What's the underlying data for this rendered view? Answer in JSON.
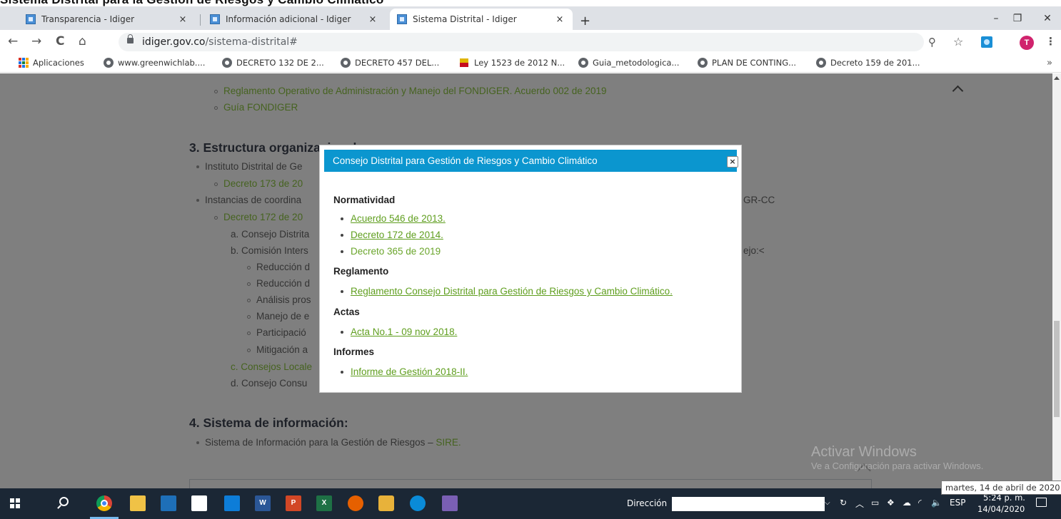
{
  "browser": {
    "tabs": [
      {
        "title": "Transparencia - Idiger",
        "close": "×"
      },
      {
        "title": "Información adicional - Idiger",
        "close": "×"
      },
      {
        "title": "Sistema Distrital - Idiger",
        "close": "×"
      }
    ],
    "new_tab": "+",
    "window_controls": {
      "minimize": "–",
      "restore": "❐",
      "close": "✕"
    },
    "nav": {
      "back": "←",
      "forward": "→",
      "reload": "C",
      "home": "⌂"
    },
    "url_host": "idiger.gov.co",
    "url_path": "/sistema-distrital#",
    "zoom_icon": "⚲",
    "star_icon": "☆",
    "avatar_letter": "T",
    "menu_icon": "⋮",
    "bookmarks": [
      "Aplicaciones",
      "www.greenwichlab....",
      "DECRETO 132 DE 2...",
      "DECRETO 457 DEL...",
      "Ley 1523 de 2012 N...",
      "Guia_metodologica...",
      "PLAN DE CONTING...",
      "Decreto 159 de 201..."
    ],
    "bookmarks_more": "»"
  },
  "page": {
    "fondiger_items": [
      "Reglamento Operativo de Administración y Manejo del FONDIGER. Acuerdo 002 de 2019",
      "Guía FONDIGER"
    ],
    "section3_heading": "3. Estructura organizacional:",
    "section3_items": [
      "Instituto Distrital de Ge",
      "Decreto 173 de 20",
      "Instancias de coordina",
      "Decreto 172 de 20",
      "a. Consejo Distrita",
      "b. Comisión Inters",
      "Reducción d",
      "Reducción d",
      "Análisis pros",
      "Manejo de e",
      "Participació",
      "Mitigación a",
      "c. Consejos Locale",
      "d. Consejo Consu"
    ],
    "right_fragments": [
      "GR-CC",
      "ejo:<"
    ],
    "section4_heading": "4. Sistema de información:",
    "section4_item_prefix": "Sistema de Información para la Gestión de Riesgos – ",
    "section4_item_link": "SIRE."
  },
  "modal": {
    "title": "Consejo Distrital para Gestión de Riesgos y Cambio Climático",
    "close": "×",
    "sections": [
      {
        "heading": "Normatividad",
        "items": [
          "Acuerdo 546 de 2013.",
          "Decreto 172 de 2014.",
          "Decreto 365 de 2019"
        ]
      },
      {
        "heading": "Reglamento",
        "items": [
          "Reglamento Consejo Distrital para Gestión de Riesgos y Cambio Climático."
        ]
      },
      {
        "heading": "Actas",
        "items": [
          "Acta No.1 - 09 nov 2018."
        ]
      },
      {
        "heading": "Informes",
        "items": [
          "Informe de Gestión 2018-II."
        ]
      }
    ]
  },
  "watermark": {
    "title": "Activar Windows",
    "subtitle": "Ve a Configuración para activar Windows."
  },
  "taskbar": {
    "address_label": "Dirección",
    "address_value": "",
    "lang": "ESP",
    "time": "5:24 p. m.",
    "date": "14/04/2020",
    "tooltip": "martes, 14 de abril de 2020",
    "office_letters": {
      "word": "W",
      "ppt": "P",
      "excel": "X"
    }
  },
  "top_caption": "Sistema Distrital para la Gestión de Riesgos y Cambio Climático"
}
